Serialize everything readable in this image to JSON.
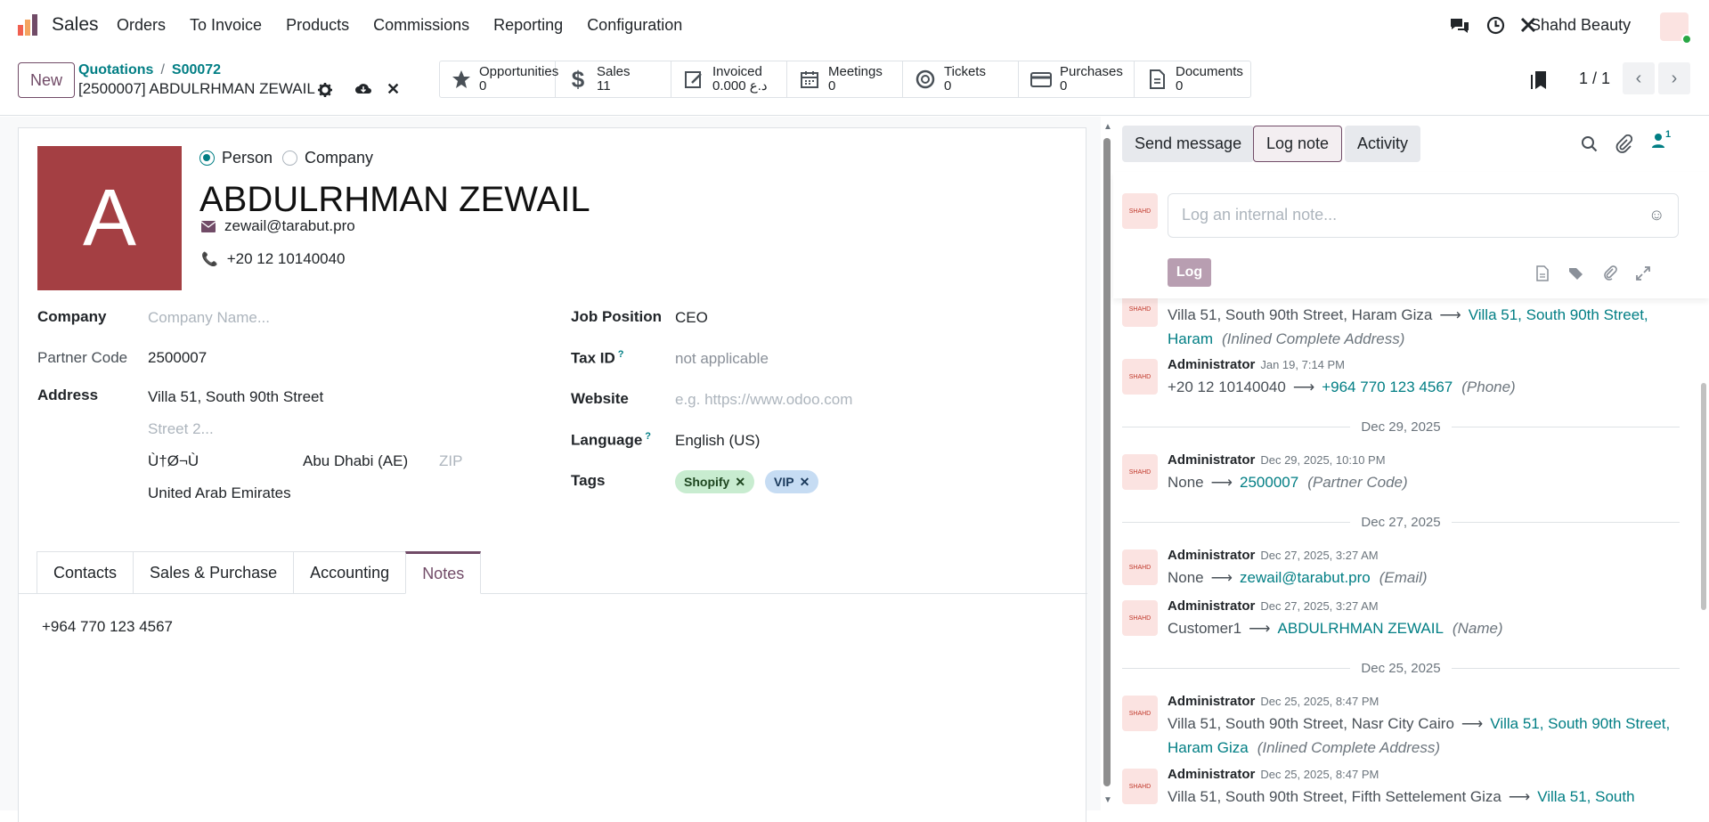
{
  "nav": {
    "app_name": "Sales",
    "menu": [
      "Orders",
      "To Invoice",
      "Products",
      "Commissions",
      "Reporting",
      "Configuration"
    ],
    "company": "Shahd Beauty"
  },
  "control": {
    "new_label": "New",
    "breadcrumb_parent": "Quotations",
    "breadcrumb_sep": "/",
    "breadcrumb_order": "S00072",
    "record_title": "[2500007] ABDULRHMAN ZEWAIL",
    "pager": "1 / 1"
  },
  "stats": [
    {
      "label": "Opportunities",
      "value": "0",
      "icon": "star-icon"
    },
    {
      "label": "Sales",
      "value": "11",
      "icon": "dollar-icon"
    },
    {
      "label": "Invoiced",
      "value": "0.000  د.ع",
      "icon": "invoice-icon"
    },
    {
      "label": "Meetings",
      "value": "0",
      "icon": "calendar-icon"
    },
    {
      "label": "Tickets",
      "value": "0",
      "icon": "lifebuoy-icon"
    },
    {
      "label": "Purchases",
      "value": "0",
      "icon": "credit-card-icon"
    },
    {
      "label": "Documents",
      "value": "0",
      "icon": "document-icon"
    }
  ],
  "partner": {
    "avatar_letter": "A",
    "type_person": "Person",
    "type_company": "Company",
    "name": "ABDULRHMAN ZEWAIL",
    "email": "zewail@tarabut.pro",
    "phone": "+20 12 10140040"
  },
  "fields": {
    "company_label": "Company",
    "company_placeholder": "Company Name...",
    "partner_code_label": "Partner Code",
    "partner_code": "2500007",
    "address_label": "Address",
    "street": "Villa 51, South 90th Street",
    "street2_placeholder": "Street 2...",
    "city": "Ù†Ø¬Ù",
    "state": "Abu Dhabi (AE)",
    "zip_placeholder": "ZIP",
    "country": "United Arab Emirates",
    "job_label": "Job Position",
    "job": "CEO",
    "taxid_label": "Tax ID",
    "taxid": "not applicable",
    "website_label": "Website",
    "website_placeholder": "e.g. https://www.odoo.com",
    "language_label": "Language",
    "language": "English (US)",
    "tags_label": "Tags",
    "tags": [
      {
        "name": "Shopify",
        "color": "#c8ecd0"
      },
      {
        "name": "VIP",
        "color": "#c6dcf3"
      }
    ],
    "help_mark": "?"
  },
  "tabs": [
    "Contacts",
    "Sales & Purchase",
    "Accounting",
    "Notes"
  ],
  "notes_text": "+964 770 123 4567",
  "chatter": {
    "send_message": "Send message",
    "log_note": "Log note",
    "activity": "Activity",
    "followers_count": "1",
    "log_placeholder": "Log an internal note...",
    "log_button": "Log",
    "avatar_text": "SHAHD",
    "messages": [
      {
        "old": "Villa 51, South 90th Street, Haram Giza",
        "new": "Villa 51, South 90th Street, Haram",
        "field": "(Inlined Complete Address)"
      },
      {
        "author": "Administrator",
        "date": "Jan 19, 7:14 PM",
        "old": "+20 12 10140040",
        "new": "+964 770 123 4567",
        "field": "(Phone)"
      },
      {
        "separator": "Dec 29, 2025"
      },
      {
        "author": "Administrator",
        "date": "Dec 29, 2025, 10:10 PM",
        "old": "None",
        "new": "2500007",
        "field": "(Partner Code)"
      },
      {
        "separator": "Dec 27, 2025"
      },
      {
        "author": "Administrator",
        "date": "Dec 27, 2025, 3:27 AM",
        "old": "None",
        "new": "zewail@tarabut.pro",
        "field": "(Email)"
      },
      {
        "author": "Administrator",
        "date": "Dec 27, 2025, 3:27 AM",
        "old": "Customer1",
        "new": "ABDULRHMAN ZEWAIL",
        "field": "(Name)"
      },
      {
        "separator": "Dec 25, 2025"
      },
      {
        "author": "Administrator",
        "date": "Dec 25, 2025, 8:47 PM",
        "old": "Villa 51, South 90th Street, Nasr City Cairo",
        "new": "Villa 51, South 90th Street, Haram Giza",
        "field": "(Inlined Complete Address)"
      },
      {
        "author": "Administrator",
        "date": "Dec 25, 2025, 8:47 PM",
        "old": "Villa 51, South 90th Street, Fifth Settelement Giza",
        "new": "Villa 51, South",
        "field": ""
      }
    ]
  },
  "colors": {
    "brand": "#714b67",
    "link": "#017e84",
    "avatar": "#a43f43"
  }
}
